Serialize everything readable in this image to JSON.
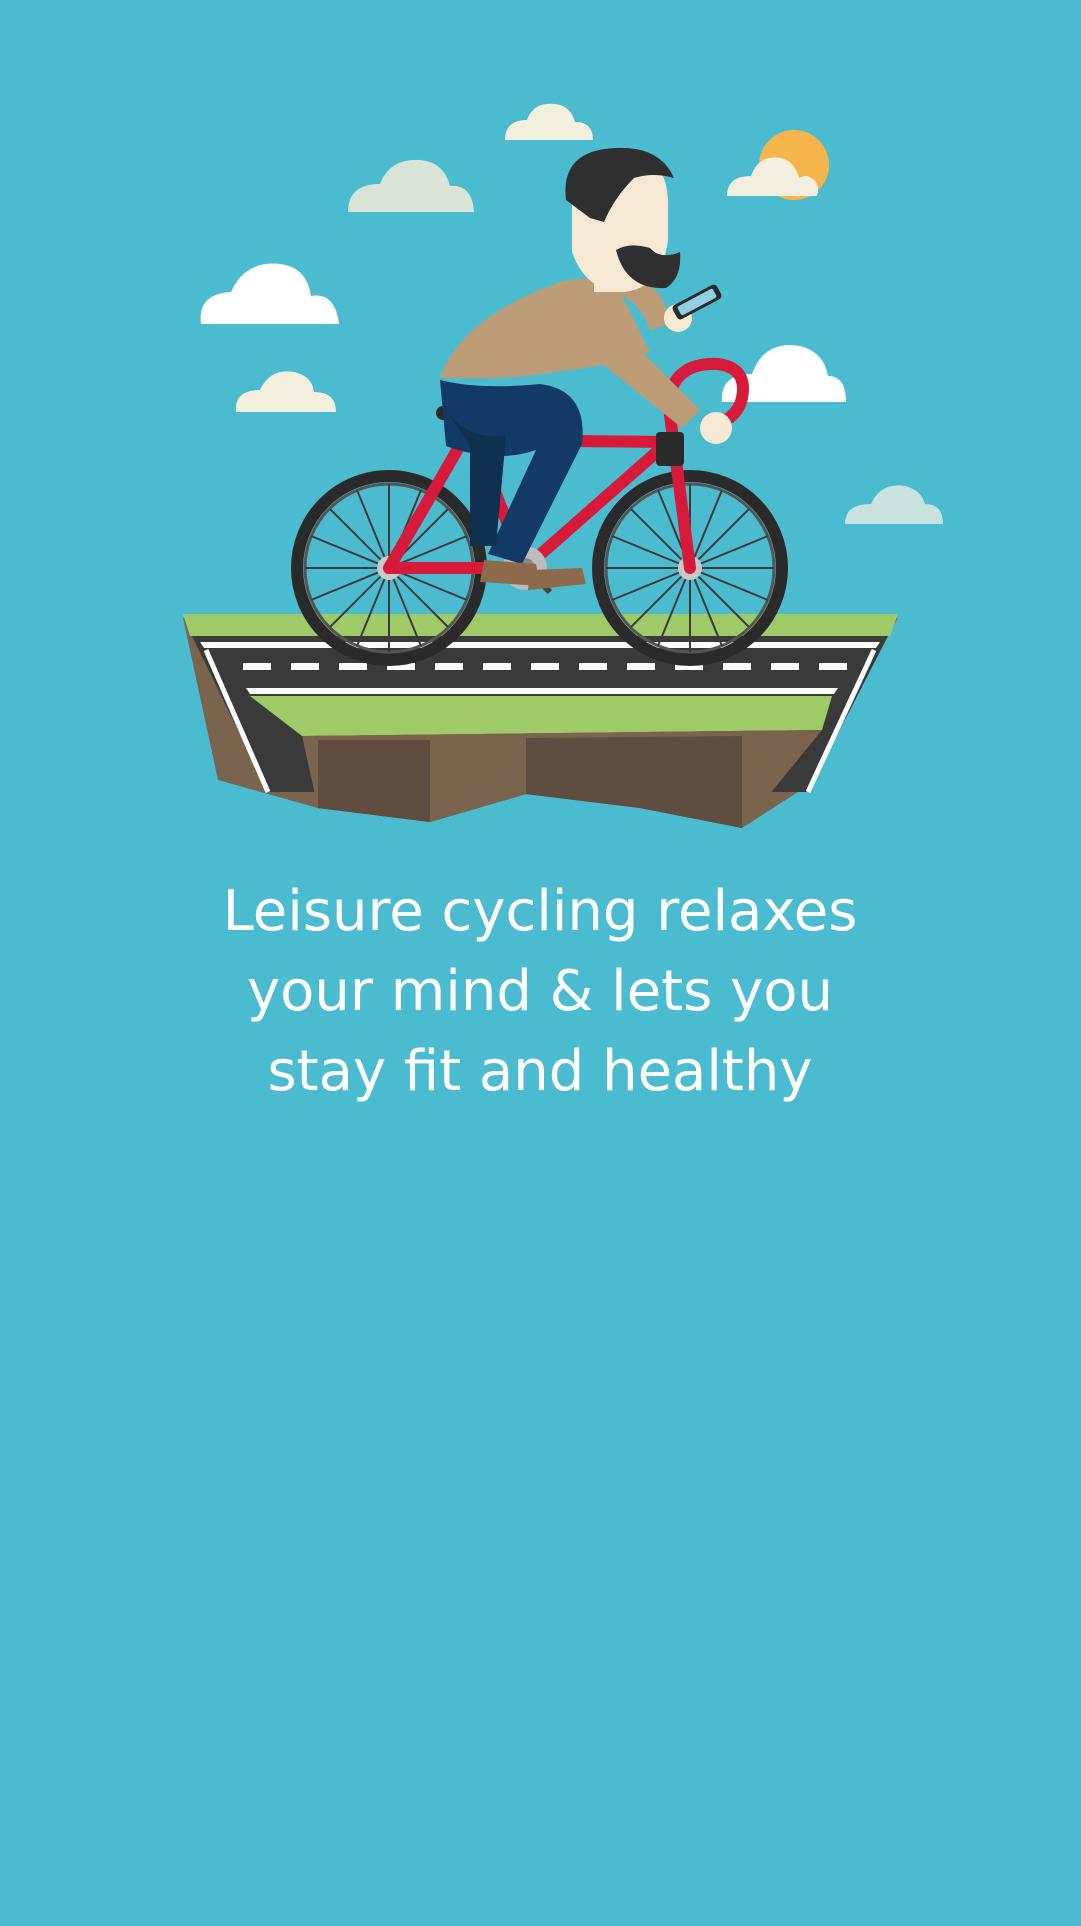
{
  "onboarding": {
    "tagline": {
      "line1": "Leisure cycling relaxes",
      "line2": "your mind & lets you",
      "line3": "stay fit and healthy"
    },
    "illustration": {
      "subject": "man-cycling-on-floating-road-island",
      "icons": [
        "sun-icon",
        "cloud-icon",
        "bicycle-icon",
        "smartphone-icon"
      ]
    }
  },
  "colors": {
    "background": "#4BBCD0",
    "bike_frame": "#D7193A",
    "grass": "#9ECB67",
    "soil": "#7A644D",
    "road": "#3A3A3A",
    "sun": "#F5B54A",
    "text": "#FFFFFF"
  }
}
